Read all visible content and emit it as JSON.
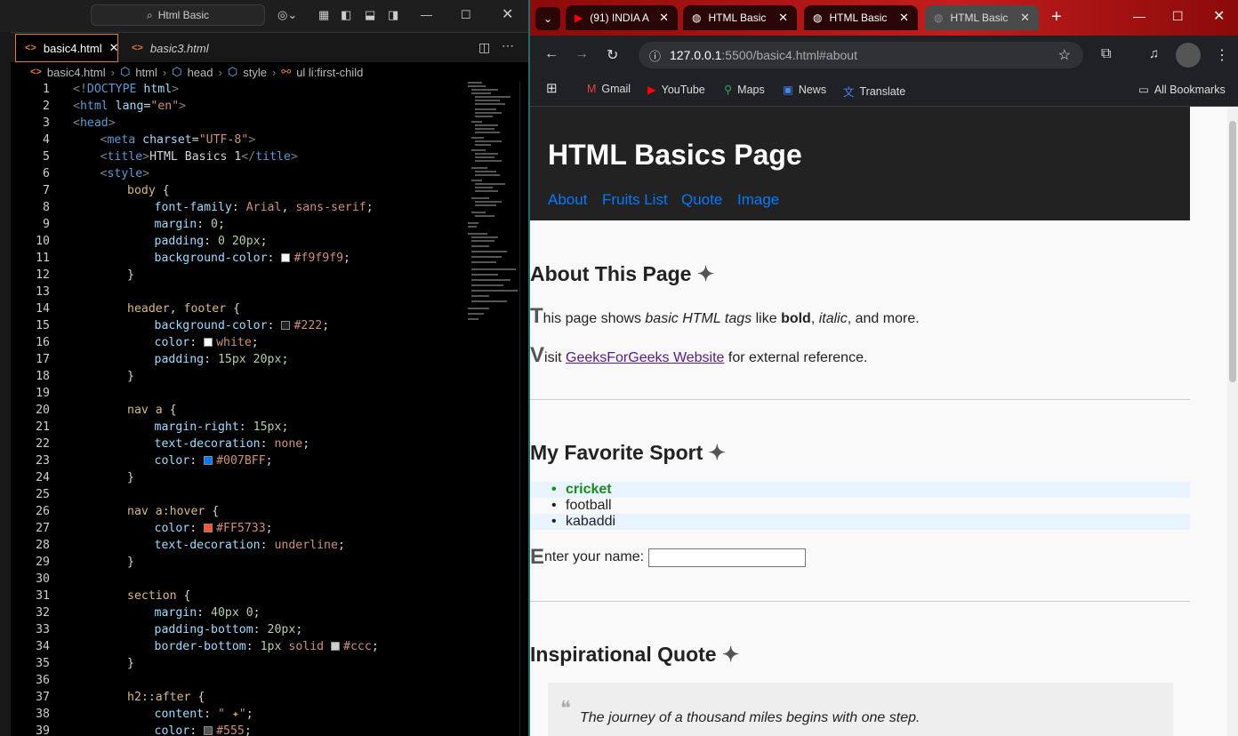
{
  "vscode": {
    "command_center": "Html Basic",
    "tabs": [
      {
        "label": "basic4.html",
        "active": true
      },
      {
        "label": "basic3.html",
        "active": false
      }
    ],
    "breadcrumb": [
      "basic4.html",
      "html",
      "head",
      "style",
      "ul li:first-child"
    ],
    "lines": [
      {
        "n": "1",
        "i": 0,
        "parts": [
          [
            "g",
            "<!"
          ],
          [
            "t",
            "DOCTYPE"
          ],
          [
            "at",
            " html"
          ],
          [
            "g",
            ">"
          ]
        ]
      },
      {
        "n": "2",
        "i": 0,
        "parts": [
          [
            "g",
            "<"
          ],
          [
            "t",
            "html"
          ],
          [
            "at",
            " lang"
          ],
          [
            "",
            "="
          ],
          [
            "s",
            "\"en\""
          ],
          [
            "g",
            ">"
          ]
        ]
      },
      {
        "n": "3",
        "i": 0,
        "parts": [
          [
            "g",
            "<"
          ],
          [
            "t",
            "head"
          ],
          [
            "g",
            ">"
          ]
        ]
      },
      {
        "n": "4",
        "i": 1,
        "parts": [
          [
            "g",
            "<"
          ],
          [
            "t",
            "meta"
          ],
          [
            "at",
            " charset"
          ],
          [
            "",
            "="
          ],
          [
            "s",
            "\"UTF-8\""
          ],
          [
            "g",
            ">"
          ]
        ]
      },
      {
        "n": "5",
        "i": 1,
        "parts": [
          [
            "g",
            "<"
          ],
          [
            "t",
            "title"
          ],
          [
            "g",
            ">"
          ],
          [
            "",
            "HTML Basics 1"
          ],
          [
            "g",
            "</"
          ],
          [
            "t",
            "title"
          ],
          [
            "g",
            ">"
          ]
        ]
      },
      {
        "n": "6",
        "i": 1,
        "parts": [
          [
            "g",
            "<"
          ],
          [
            "t",
            "style"
          ],
          [
            "g",
            ">"
          ]
        ]
      },
      {
        "n": "7",
        "i": 2,
        "parts": [
          [
            "p",
            "body"
          ],
          [
            "",
            " {"
          ]
        ]
      },
      {
        "n": "8",
        "i": 3,
        "parts": [
          [
            "pr",
            "font-family"
          ],
          [
            "",
            ": "
          ],
          [
            "v",
            "Arial"
          ],
          [
            "",
            ", "
          ],
          [
            "v",
            "sans-serif"
          ],
          [
            "",
            ";"
          ]
        ]
      },
      {
        "n": "9",
        "i": 3,
        "parts": [
          [
            "pr",
            "margin"
          ],
          [
            "",
            ": "
          ],
          [
            "n",
            "0"
          ],
          [
            "",
            ";"
          ]
        ]
      },
      {
        "n": "10",
        "i": 3,
        "parts": [
          [
            "pr",
            "padding"
          ],
          [
            "",
            ": "
          ],
          [
            "n",
            "0 20px"
          ],
          [
            "",
            ";"
          ]
        ]
      },
      {
        "n": "11",
        "i": 3,
        "parts": [
          [
            "pr",
            "background-color"
          ],
          [
            "",
            ": "
          ],
          [
            "sw",
            "#f9f9f9"
          ],
          [
            "v",
            "#f9f9f9"
          ],
          [
            "",
            ";"
          ]
        ]
      },
      {
        "n": "12",
        "i": 2,
        "parts": [
          [
            "",
            "}"
          ]
        ]
      },
      {
        "n": "13",
        "i": 0,
        "parts": []
      },
      {
        "n": "14",
        "i": 2,
        "parts": [
          [
            "p",
            "header"
          ],
          [
            "",
            ", "
          ],
          [
            "p",
            "footer"
          ],
          [
            "",
            " {"
          ]
        ]
      },
      {
        "n": "15",
        "i": 3,
        "parts": [
          [
            "pr",
            "background-color"
          ],
          [
            "",
            ": "
          ],
          [
            "sw",
            "#222222"
          ],
          [
            "v",
            "#222"
          ],
          [
            "",
            ";"
          ]
        ]
      },
      {
        "n": "16",
        "i": 3,
        "parts": [
          [
            "pr",
            "color"
          ],
          [
            "",
            ": "
          ],
          [
            "sw",
            "#ffffff"
          ],
          [
            "v",
            "white"
          ],
          [
            "",
            ";"
          ]
        ]
      },
      {
        "n": "17",
        "i": 3,
        "parts": [
          [
            "pr",
            "padding"
          ],
          [
            "",
            ": "
          ],
          [
            "n",
            "15px 20px"
          ],
          [
            "",
            ";"
          ]
        ]
      },
      {
        "n": "18",
        "i": 2,
        "parts": [
          [
            "",
            "}"
          ]
        ]
      },
      {
        "n": "19",
        "i": 0,
        "parts": []
      },
      {
        "n": "20",
        "i": 2,
        "parts": [
          [
            "p",
            "nav a"
          ],
          [
            "",
            " {"
          ]
        ]
      },
      {
        "n": "21",
        "i": 3,
        "parts": [
          [
            "pr",
            "margin-right"
          ],
          [
            "",
            ": "
          ],
          [
            "n",
            "15px"
          ],
          [
            "",
            ";"
          ]
        ]
      },
      {
        "n": "22",
        "i": 3,
        "parts": [
          [
            "pr",
            "text-decoration"
          ],
          [
            "",
            ": "
          ],
          [
            "v",
            "none"
          ],
          [
            "",
            ";"
          ]
        ]
      },
      {
        "n": "23",
        "i": 3,
        "parts": [
          [
            "pr",
            "color"
          ],
          [
            "",
            ": "
          ],
          [
            "sw",
            "#007BFF"
          ],
          [
            "v",
            "#007BFF"
          ],
          [
            "",
            ";"
          ]
        ]
      },
      {
        "n": "24",
        "i": 2,
        "parts": [
          [
            "",
            "}"
          ]
        ]
      },
      {
        "n": "25",
        "i": 0,
        "parts": []
      },
      {
        "n": "26",
        "i": 2,
        "parts": [
          [
            "p",
            "nav a:hover"
          ],
          [
            "",
            " {"
          ]
        ]
      },
      {
        "n": "27",
        "i": 3,
        "parts": [
          [
            "pr",
            "color"
          ],
          [
            "",
            ": "
          ],
          [
            "sw",
            "#FF5733"
          ],
          [
            "v",
            "#FF5733"
          ],
          [
            "",
            ";"
          ]
        ]
      },
      {
        "n": "28",
        "i": 3,
        "parts": [
          [
            "pr",
            "text-decoration"
          ],
          [
            "",
            ": "
          ],
          [
            "v",
            "underline"
          ],
          [
            "",
            ";"
          ]
        ]
      },
      {
        "n": "29",
        "i": 2,
        "parts": [
          [
            "",
            "}"
          ]
        ]
      },
      {
        "n": "30",
        "i": 0,
        "parts": []
      },
      {
        "n": "31",
        "i": 2,
        "parts": [
          [
            "p",
            "section"
          ],
          [
            "",
            " {"
          ]
        ]
      },
      {
        "n": "32",
        "i": 3,
        "parts": [
          [
            "pr",
            "margin"
          ],
          [
            "",
            ": "
          ],
          [
            "n",
            "40px 0"
          ],
          [
            "",
            ";"
          ]
        ]
      },
      {
        "n": "33",
        "i": 3,
        "parts": [
          [
            "pr",
            "padding-bottom"
          ],
          [
            "",
            ": "
          ],
          [
            "n",
            "20px"
          ],
          [
            "",
            ";"
          ]
        ]
      },
      {
        "n": "34",
        "i": 3,
        "parts": [
          [
            "pr",
            "border-bottom"
          ],
          [
            "",
            ": "
          ],
          [
            "n",
            "1px"
          ],
          [
            "",
            " "
          ],
          [
            "v",
            "solid"
          ],
          [
            "",
            " "
          ],
          [
            "sw",
            "#cccccc"
          ],
          [
            "v",
            "#ccc"
          ],
          [
            "",
            ";"
          ]
        ]
      },
      {
        "n": "35",
        "i": 2,
        "parts": [
          [
            "",
            "}"
          ]
        ]
      },
      {
        "n": "36",
        "i": 0,
        "parts": []
      },
      {
        "n": "37",
        "i": 2,
        "parts": [
          [
            "p",
            "h2::after"
          ],
          [
            "",
            " {"
          ]
        ]
      },
      {
        "n": "38",
        "i": 3,
        "parts": [
          [
            "pr",
            "content"
          ],
          [
            "",
            ": "
          ],
          [
            "s",
            "\" ✦\""
          ],
          [
            "",
            ";"
          ]
        ]
      },
      {
        "n": "39",
        "i": 3,
        "parts": [
          [
            "pr",
            "color"
          ],
          [
            "",
            ": "
          ],
          [
            "sw",
            "#555555"
          ],
          [
            "v",
            "#555"
          ],
          [
            "",
            ";"
          ]
        ]
      }
    ]
  },
  "chrome": {
    "tabs": [
      {
        "label": "(91) INDIA A",
        "icon": "youtube-icon"
      },
      {
        "label": "HTML Basic",
        "icon": "globe-icon"
      },
      {
        "label": "HTML Basic",
        "icon": "globe-icon"
      },
      {
        "label": "HTML Basic",
        "icon": "globe-icon",
        "active": true
      }
    ],
    "url_host": "127.0.0.1",
    "url_rest": ":5500/basic4.html#about",
    "bookmarks": [
      "Gmail",
      "YouTube",
      "Maps",
      "News",
      "Translate"
    ],
    "all_bookmarks": "All Bookmarks"
  },
  "page": {
    "title": "HTML Basics Page",
    "nav": [
      "About",
      "Fruits List",
      "Quote",
      "Image"
    ],
    "about_heading": "About This Page",
    "star": "✦",
    "p1": {
      "cap": "T",
      "a": "his page shows ",
      "em": "basic HTML tags",
      "b": " like ",
      "strong": "bold",
      "c": ", ",
      "i": "italic",
      "d": ", and more."
    },
    "p2": {
      "cap": "V",
      "a": "isit ",
      "link": "GeeksForGeeks Website",
      "b": " for external reference."
    },
    "sport_heading": "My Favorite Sport",
    "sports": [
      "cricket",
      "football",
      "kabaddi"
    ],
    "name_cap": "E",
    "name_label": "nter your name:",
    "quote_heading": "Inspirational Quote",
    "quote_mark": "❝",
    "quote_text": "The journey of a thousand miles begins with one step."
  }
}
